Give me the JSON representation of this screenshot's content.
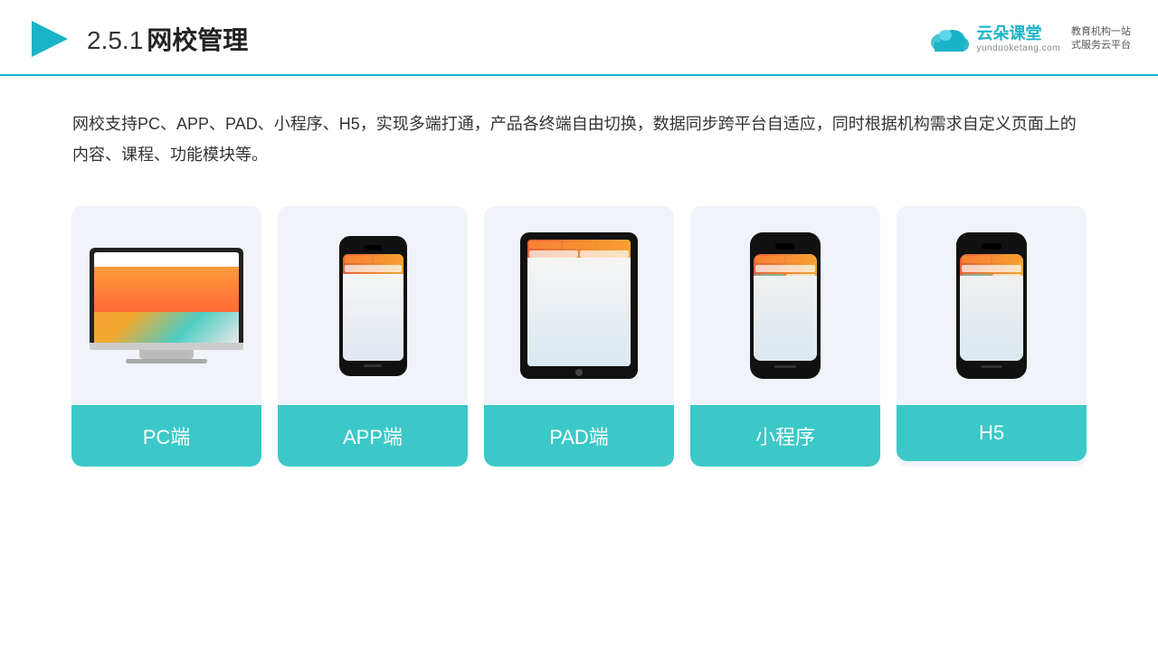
{
  "header": {
    "title": "网校管理",
    "title_num": "2.5.1",
    "brand": {
      "name": "云朵课堂",
      "url": "yunduoketang.com",
      "tagline": "教育机构一站\n式服务云平台"
    }
  },
  "description": {
    "text": "网校支持PC、APP、PAD、小程序、H5，实现多端打通，产品各终端自由切换，数据同步跨平台自适应，同时根据机构需求自定义页面上的内容、课程、功能模块等。"
  },
  "cards": [
    {
      "label": "PC端",
      "type": "pc"
    },
    {
      "label": "APP端",
      "type": "phone"
    },
    {
      "label": "PAD端",
      "type": "tablet"
    },
    {
      "label": "小程序",
      "type": "mini-phone"
    },
    {
      "label": "H5",
      "type": "mini-phone2"
    }
  ]
}
